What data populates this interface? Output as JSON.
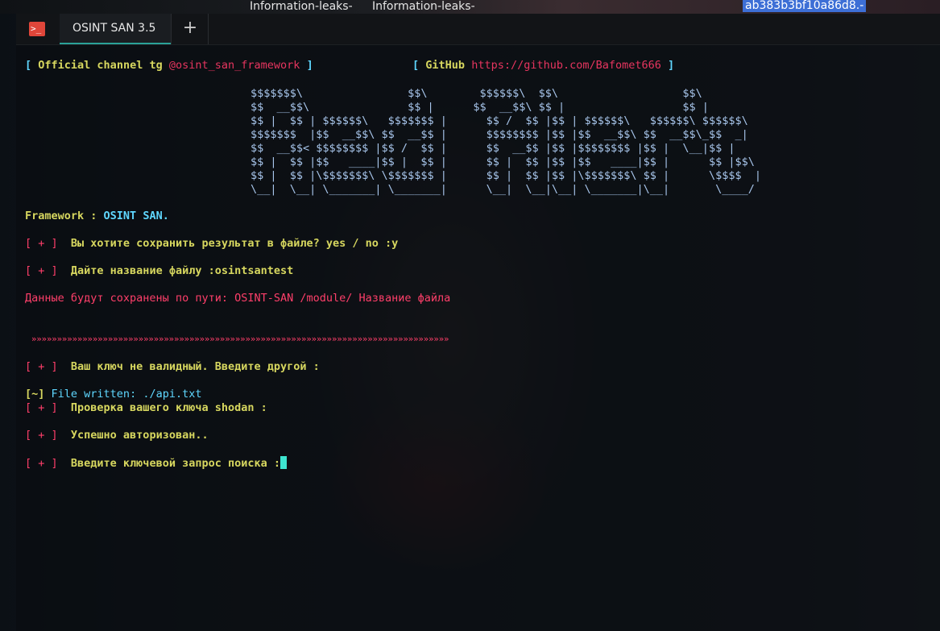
{
  "desktop": {
    "label_1": "Information-leaks-",
    "label_2": "Information-leaks-",
    "hash_label": "ab383b3bf10a86d8.-"
  },
  "terminal": {
    "tab_title": "OSINT SAN 3.5",
    "tab_icon_glyph": ">_",
    "new_tab_glyph": "+",
    "header": {
      "channel_open": "[",
      "channel_label": "Official channel tg",
      "channel_handle": "@osint_san_framework",
      "channel_close": "]",
      "github_open": "[",
      "github_label": "GitHub",
      "github_url": "https://github.com/Bafomet666",
      "github_close": "]"
    },
    "ascii_banner": [
      "$$$$$$$\\                $$\\        $$$$$$\\  $$\\                   $$\\",
      "$$  __$$\\               $$ |      $$  __$$\\ $$ |                  $$ |",
      "$$ |  $$ | $$$$$$\\   $$$$$$$ |      $$ /  $$ |$$ | $$$$$$\\   $$$$$$\\ $$$$$$\\",
      "$$$$$$$  |$$  __$$\\ $$  __$$ |      $$$$$$$$ |$$ |$$  __$$\\ $$  __$$\\_$$  _|",
      "$$  __$$< $$$$$$$$ |$$ /  $$ |      $$  __$$ |$$ |$$$$$$$$ |$$ |  \\__|$$ |",
      "$$ |  $$ |$$   ____|$$ |  $$ |      $$ |  $$ |$$ |$$   ____|$$ |      $$ |$$\\",
      "$$ |  $$ |\\$$$$$$$\\ \\$$$$$$$ |      $$ |  $$ |$$ |\\$$$$$$$\\ $$ |      \\$$$$  |",
      "\\__|  \\__| \\_______| \\_______|      \\__|  \\__|\\__| \\_______|\\__|       \\____/"
    ],
    "framework_label": "Framework :",
    "framework_name": "OSINT SAN.",
    "prompt_marker": "[ + ]",
    "q_save": "Вы хотите сохранить результат в файле? yes / no :y",
    "q_filename": "Дайте название файлу :osintsantest",
    "save_path_note": "Данные будут сохранены по пути: OSINT-SAN /module/ Название файла",
    "separator": "»»»»»»»»»»»»»»»»»»»»»»»»»»»»»»»»»»»»»»»»»»»»»»»»»»»»»»»»»»»»»»»»»»»»»»»»»»»»»»»»»»",
    "key_invalid": "Ваш ключ не валидный. Введите другой :",
    "file_written_marker": "[~]",
    "file_written": "File written: ./api.txt",
    "key_check": "Проверка вашего ключа shodan :",
    "auth_ok": "Успешно авторизован..",
    "search_prompt": "Введите ключевой запрос поиска :"
  },
  "colors": {
    "cyan": "#5fd7ff",
    "yellow": "#d7d75f",
    "red": "#ff3f6a",
    "ascii": "#a8c6ec",
    "cursor": "#3ee5d0",
    "tab_accent": "#2aa198"
  }
}
